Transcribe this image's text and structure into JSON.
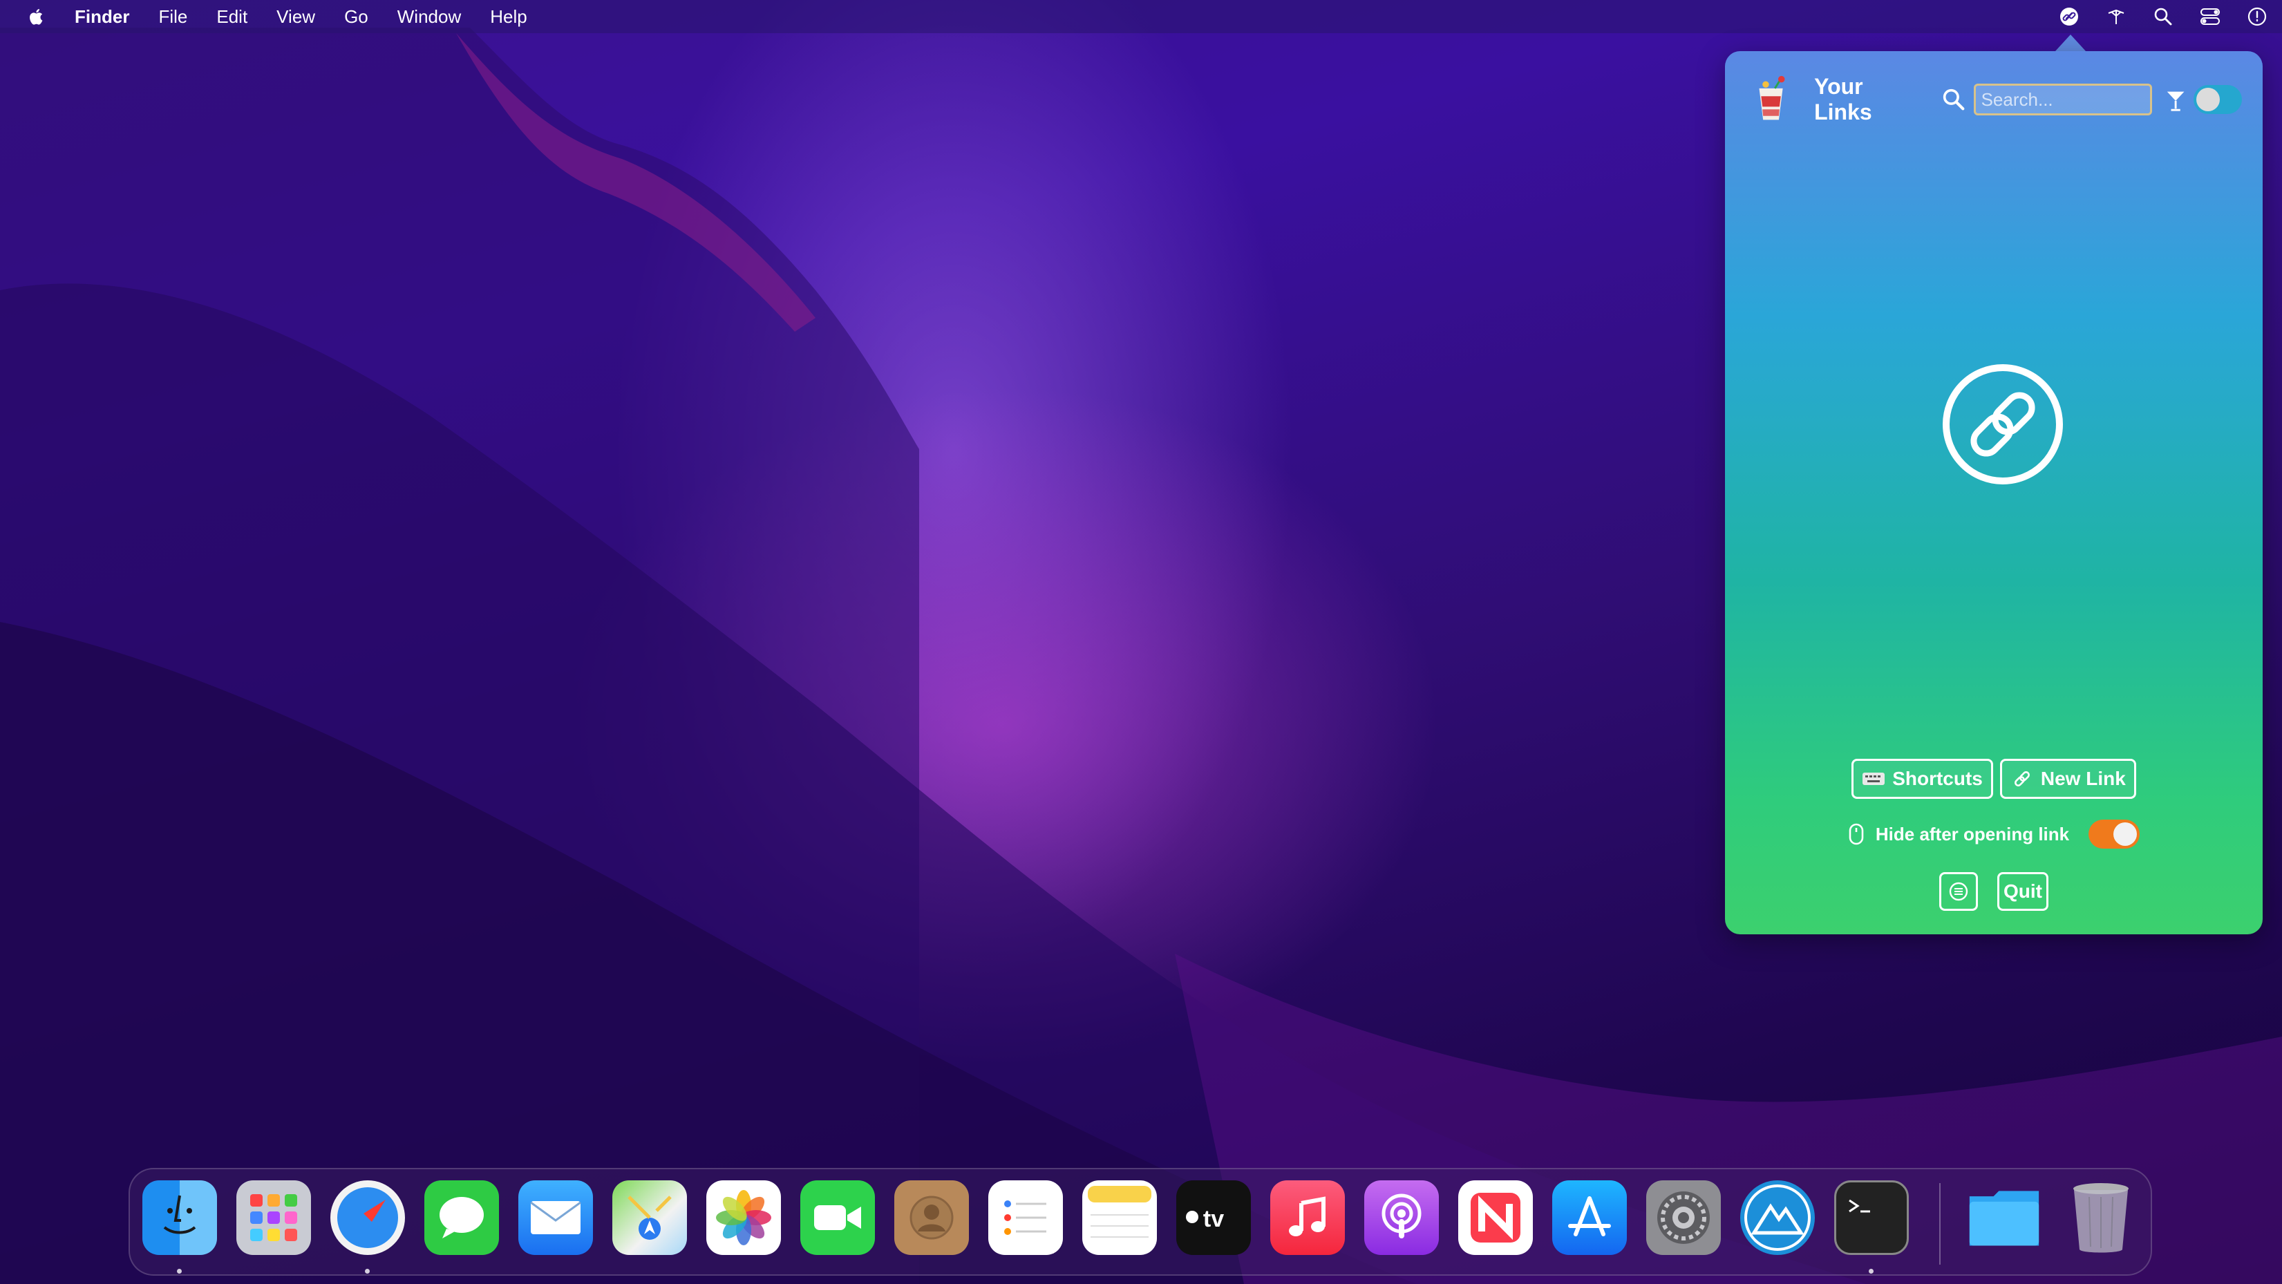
{
  "menubar": {
    "app_name": "Finder",
    "menus": [
      "File",
      "Edit",
      "View",
      "Go",
      "Window",
      "Help"
    ],
    "status_icons": [
      "link-icon",
      "bluetooth-icon",
      "search-icon",
      "control-center-icon",
      "siri-icon"
    ]
  },
  "popover": {
    "title": "Your Links",
    "search_placeholder": "Search...",
    "empty_state_icon": "link-icon",
    "shortcuts_label": "Shortcuts",
    "new_link_label": "New Link",
    "hide_after_label": "Hide after opening link",
    "hide_after_enabled": true,
    "filter_toggle_enabled": false,
    "quit_label": "Quit",
    "colors": {
      "toggle_on": "#f07a1c",
      "gradient_top": "#5b88e4",
      "gradient_bottom": "#3cd06e"
    }
  },
  "dock": {
    "apps": [
      "Finder",
      "Launchpad",
      "Safari",
      "Messages",
      "Mail",
      "Maps",
      "Photos",
      "FaceTime",
      "Contacts",
      "Reminders",
      "Notes",
      "TV",
      "Music",
      "Podcasts",
      "News",
      "App Store",
      "System Preferences",
      "Artstudio",
      "Terminal",
      "Downloads",
      "Trash"
    ],
    "running": [
      "Finder",
      "Safari",
      "Terminal"
    ]
  }
}
